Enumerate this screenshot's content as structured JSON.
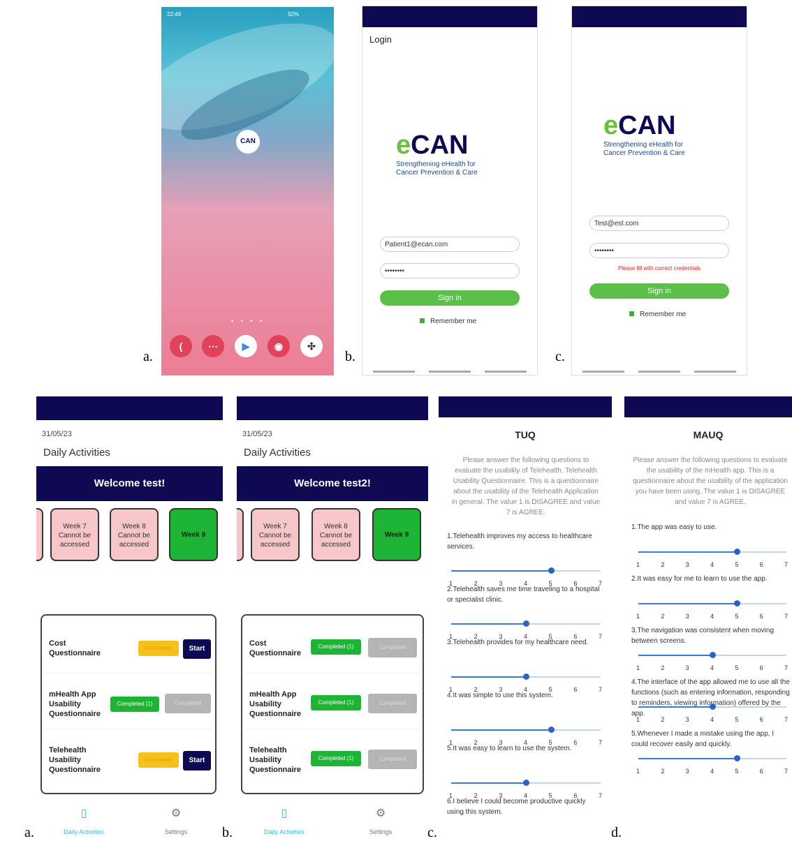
{
  "labels": {
    "a1": "a.",
    "b1": "b.",
    "c1": "c.",
    "a2": "a.",
    "b2": "b.",
    "c2": "c.",
    "d2": "d."
  },
  "home": {
    "time": "22:49",
    "status_right": "92%",
    "app_label": "CAN",
    "page_dots": "• • • •",
    "dock": [
      {
        "icon": "phone-icon",
        "glyph": "(",
        "color": "#e0425c"
      },
      {
        "icon": "messages-icon",
        "glyph": "⋯",
        "color": "#e0425c"
      },
      {
        "icon": "play-store-icon",
        "glyph": "▶",
        "color": "#ffffff"
      },
      {
        "icon": "camera-icon",
        "glyph": "◉",
        "color": "#e0425c"
      },
      {
        "icon": "apps-icon",
        "glyph": "✣",
        "color": "#ffffff"
      }
    ]
  },
  "logo": {
    "e": "e",
    "can": "CAN",
    "tagline1": "Strengthening eHealth for",
    "tagline2": "Cancer Prevention & Care"
  },
  "login_b": {
    "title": "Login",
    "email": "Patient1@ecan.com",
    "password": "••••••••",
    "signin": "Sign in",
    "remember": "Remember me"
  },
  "login_c": {
    "email": "Test@est.com",
    "password": "••••••••",
    "error": "Please fill with correct credentials",
    "signin": "Sign in",
    "remember": "Remember me"
  },
  "act_a": {
    "date": "31/05/23",
    "title": "Daily Activities",
    "welcome": "Welcome test!",
    "weeks": [
      {
        "label": "Week 7\nCannot be\naccessed"
      },
      {
        "label": "Week 8\nCannot be\naccessed"
      },
      {
        "label": "Week 9"
      }
    ],
    "rows": [
      {
        "name": "Cost Questionnaire",
        "status": "Incomplete",
        "action": "Start"
      },
      {
        "name": "mHealth App Usability Questionnaire",
        "status": "Completed (1)",
        "action": "Completed"
      },
      {
        "name": "Telehealth Usability Questionnaire",
        "status": "Incomplete",
        "action": "Start"
      }
    ],
    "tab1": "Daily Activities",
    "tab2": "Settings"
  },
  "act_b": {
    "date": "31/05/23",
    "title": "Daily Activities",
    "welcome": "Welcome test2!",
    "weeks": [
      {
        "label": "Week 7\nCannot be\naccessed"
      },
      {
        "label": "Week 8\nCannot be\naccessed"
      },
      {
        "label": "Week 9"
      }
    ],
    "rows": [
      {
        "name": "Cost Questionnaire",
        "status": "Completed (1)",
        "action": "Completed"
      },
      {
        "name": "mHealth App Usability Questionnaire",
        "status": "Completed (1)",
        "action": "Completed"
      },
      {
        "name": "Telehealth Usability Questionnaire",
        "status": "Completed (1)",
        "action": "Completed"
      }
    ],
    "tab1": "Daily Activities",
    "tab2": "Settings"
  },
  "tuq": {
    "title": "TUQ",
    "intro": "Please answer the following questions to evaluate the usability of Telehealth. Telehealth Usability Questionnaire. This is a questionnaire about the usability of the Telehealth Application in general. The value 1 is DISAGREE and value 7 is AGREE.",
    "questions": [
      {
        "text": "1.Telehealth improves my access to healthcare services.",
        "value": 5
      },
      {
        "text": "2.Telehealth saves me time traveling to a hospital or specialist clinic.",
        "value": 4
      },
      {
        "text": "3.Telehealth provides for my healthcare need.",
        "value": 4
      },
      {
        "text": "4.It was simple to use this system.",
        "value": 5
      },
      {
        "text": "5.It was easy to learn to use the system.",
        "value": 4
      },
      {
        "text": "6.I believe I could become productive quickly using this system.",
        "value": null
      }
    ]
  },
  "mauq": {
    "title": "MAUQ",
    "intro": "Please answer the following questions to evaluate the usability of the mHealth app. This is a questionnaire about the usability of the application you have been using. The value 1 is DISAGREE and value 7 is AGREE.",
    "questions": [
      {
        "text": "1.The app was easy to use.",
        "value": 5
      },
      {
        "text": "2.It was easy for me to learn to use the app.",
        "value": 5
      },
      {
        "text": "3.The navigation was consistent when moving between screens.",
        "value": 4
      },
      {
        "text": "4.The interface of the app allowed me to use all the functions (such as entering information, responding to reminders, viewing information) offered by the app.",
        "value": 4
      },
      {
        "text": "5.Whenever I made a mistake using the app, I could recover easily and quickly.",
        "value": 5
      }
    ]
  },
  "scale": [
    "1",
    "2",
    "3",
    "4",
    "5",
    "6",
    "7"
  ],
  "colors": {
    "navy": "#0d0a52",
    "green": "#1db334",
    "pink": "#f6c6c8",
    "yellow": "#f6c21a"
  }
}
